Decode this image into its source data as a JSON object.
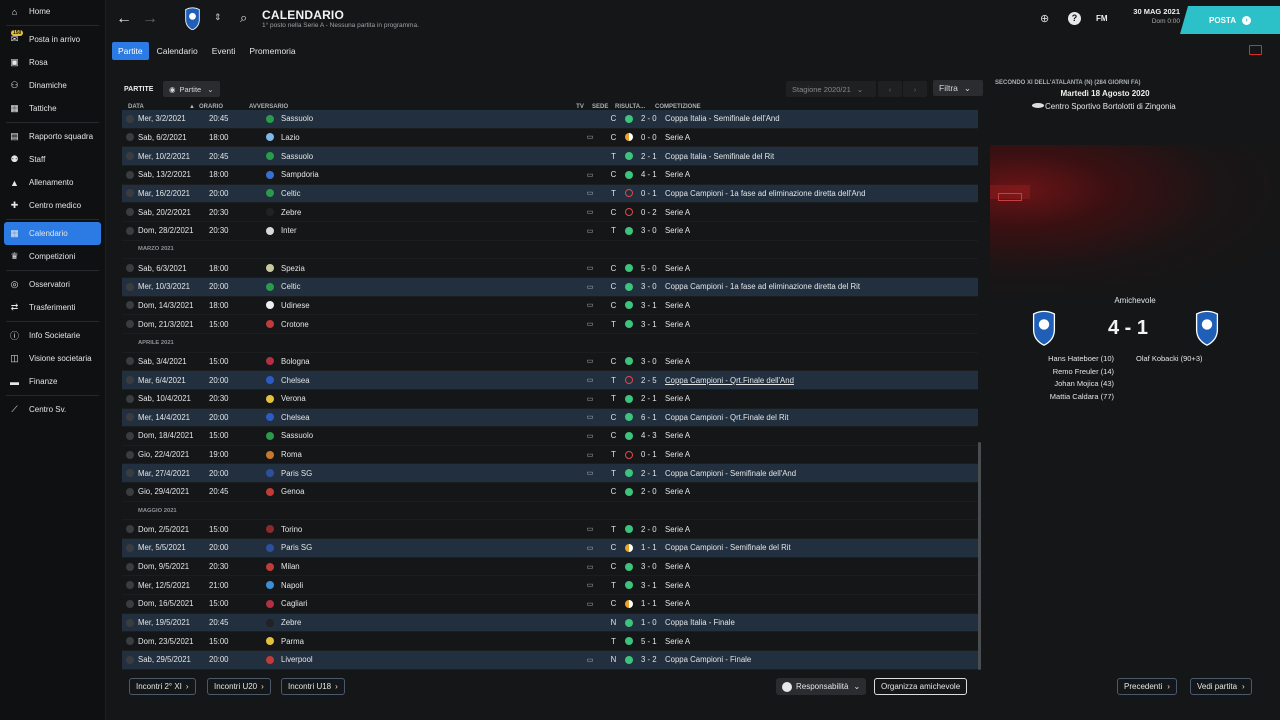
{
  "sidebar": {
    "items": [
      {
        "label": "Home",
        "icon": "home-icon",
        "glyph": "⌂"
      },
      {
        "label": "Posta in arrivo",
        "icon": "inbox-icon",
        "glyph": "✉",
        "badge": "150"
      },
      {
        "label": "Rosa",
        "icon": "shirt-icon",
        "glyph": "▣"
      },
      {
        "label": "Dinamiche",
        "icon": "dynamics-icon",
        "glyph": "⚇"
      },
      {
        "label": "Tattiche",
        "icon": "tactics-icon",
        "glyph": "▦"
      },
      {
        "label": "Rapporto squadra",
        "icon": "report-icon",
        "glyph": "▤"
      },
      {
        "label": "Staff",
        "icon": "staff-icon",
        "glyph": "⚉"
      },
      {
        "label": "Allenamento",
        "icon": "training-icon",
        "glyph": "▲"
      },
      {
        "label": "Centro medico",
        "icon": "medical-icon",
        "glyph": "✚"
      },
      {
        "label": "Calendario",
        "icon": "calendar-icon",
        "glyph": "▦",
        "active": true
      },
      {
        "label": "Competizioni",
        "icon": "trophy-icon",
        "glyph": "♛"
      },
      {
        "label": "Osservatori",
        "icon": "scout-icon",
        "glyph": "◎"
      },
      {
        "label": "Trasferimenti",
        "icon": "transfer-icon",
        "glyph": "⇄"
      },
      {
        "label": "Info Societarie",
        "icon": "info-icon",
        "glyph": "ⓘ"
      },
      {
        "label": "Visione societaria",
        "icon": "vision-icon",
        "glyph": "◫"
      },
      {
        "label": "Finanze",
        "icon": "finance-icon",
        "glyph": "▬"
      },
      {
        "label": "Centro Sv.",
        "icon": "dev-centre-icon",
        "glyph": "⟋"
      }
    ]
  },
  "header": {
    "title": "CALENDARIO",
    "subtitle": "1° posto nella Serie A - Nessuna partita in programma.",
    "fm_label": "FM",
    "date": "30 MAG 2021",
    "time": "Dom 0:00",
    "posta_label": "POSTA"
  },
  "tabs": [
    "Partite",
    "Calendario",
    "Eventi",
    "Promemoria"
  ],
  "controls": {
    "partite_label": "PARTITE",
    "view_dropdown": "Partite",
    "season_dropdown": "Stagione 2020/21",
    "filter_label": "Filtra"
  },
  "table": {
    "headers": {
      "date": "DATA",
      "time": "ORARIO",
      "opponent": "AVVERSARIO",
      "tv": "TV",
      "venue": "SEDE",
      "result": "RISULTA...",
      "competition": "COMPETIZIONE"
    },
    "rows": [
      {
        "date": "Mer, 3/2/2021",
        "time": "20:45",
        "opp": "Sassuolo",
        "crest": "#2a9a4b",
        "tv": false,
        "venue": "C",
        "res": "2 - 0",
        "dot": "win",
        "comp": "Coppa Italia - Semifinale dell'And",
        "alt": true
      },
      {
        "date": "Sab, 6/2/2021",
        "time": "18:00",
        "opp": "Lazio",
        "crest": "#7fb7e6",
        "tv": true,
        "venue": "C",
        "res": "0 - 0",
        "dot": "draw",
        "comp": "Serie A"
      },
      {
        "date": "Mer, 10/2/2021",
        "time": "20:45",
        "opp": "Sassuolo",
        "crest": "#2a9a4b",
        "tv": false,
        "venue": "T",
        "res": "2 - 1",
        "dot": "win",
        "comp": "Coppa Italia - Semifinale del Rit",
        "alt": true
      },
      {
        "date": "Sab, 13/2/2021",
        "time": "18:00",
        "opp": "Sampdoria",
        "crest": "#3a6fcf",
        "tv": true,
        "venue": "C",
        "res": "4 - 1",
        "dot": "win",
        "comp": "Serie A"
      },
      {
        "date": "Mar, 16/2/2021",
        "time": "20:00",
        "opp": "Celtic",
        "crest": "#2a9a4b",
        "tv": true,
        "venue": "T",
        "res": "0 - 1",
        "dot": "loss",
        "comp": "Coppa Campioni - 1a fase ad eliminazione diretta dell'And",
        "alt": true
      },
      {
        "date": "Sab, 20/2/2021",
        "time": "20:30",
        "opp": "Zebre",
        "crest": "#222",
        "tv": true,
        "venue": "C",
        "res": "0 - 2",
        "dot": "loss",
        "comp": "Serie A"
      },
      {
        "date": "Dom, 28/2/2021",
        "time": "20:30",
        "opp": "Inter",
        "crest": "#d8d8d8",
        "tv": true,
        "venue": "T",
        "res": "3 - 0",
        "dot": "win",
        "comp": "Serie A"
      },
      {
        "month": "MARZO 2021"
      },
      {
        "date": "Sab, 6/3/2021",
        "time": "18:00",
        "opp": "Spezia",
        "crest": "#c9c9a0",
        "tv": true,
        "venue": "C",
        "res": "5 - 0",
        "dot": "win",
        "comp": "Serie A"
      },
      {
        "date": "Mer, 10/3/2021",
        "time": "20:00",
        "opp": "Celtic",
        "crest": "#2a9a4b",
        "tv": true,
        "venue": "C",
        "res": "3 - 0",
        "dot": "win",
        "comp": "Coppa Campioni - 1a fase ad eliminazione diretta del Rit",
        "alt": true
      },
      {
        "date": "Dom, 14/3/2021",
        "time": "18:00",
        "opp": "Udinese",
        "crest": "#eeeeee",
        "tv": true,
        "venue": "C",
        "res": "3 - 1",
        "dot": "win",
        "comp": "Serie A"
      },
      {
        "date": "Dom, 21/3/2021",
        "time": "15:00",
        "opp": "Crotone",
        "crest": "#c23a3a",
        "tv": true,
        "venue": "T",
        "res": "3 - 1",
        "dot": "win",
        "comp": "Serie A"
      },
      {
        "month": "APRILE 2021"
      },
      {
        "date": "Sab, 3/4/2021",
        "time": "15:00",
        "opp": "Bologna",
        "crest": "#b23042",
        "tv": true,
        "venue": "C",
        "res": "3 - 0",
        "dot": "win",
        "comp": "Serie A"
      },
      {
        "date": "Mar, 6/4/2021",
        "time": "20:00",
        "opp": "Chelsea",
        "crest": "#2d5bc4",
        "tv": true,
        "venue": "T",
        "res": "2 - 5",
        "dot": "loss",
        "comp": "Coppa Campioni - Qrt.Finale dell'And",
        "alt": true,
        "ul": true
      },
      {
        "date": "Sab, 10/4/2021",
        "time": "20:30",
        "opp": "Verona",
        "crest": "#e3c23a",
        "tv": true,
        "venue": "T",
        "res": "2 - 1",
        "dot": "win",
        "comp": "Serie A"
      },
      {
        "date": "Mer, 14/4/2021",
        "time": "20:00",
        "opp": "Chelsea",
        "crest": "#2d5bc4",
        "tv": true,
        "venue": "C",
        "res": "6 - 1",
        "dot": "win",
        "comp": "Coppa Campioni - Qrt.Finale del Rit",
        "alt": true
      },
      {
        "date": "Dom, 18/4/2021",
        "time": "15:00",
        "opp": "Sassuolo",
        "crest": "#2a9a4b",
        "tv": true,
        "venue": "C",
        "res": "4 - 3",
        "dot": "win",
        "comp": "Serie A"
      },
      {
        "date": "Gio, 22/4/2021",
        "time": "19:00",
        "opp": "Roma",
        "crest": "#c8782a",
        "tv": true,
        "venue": "T",
        "res": "0 - 1",
        "dot": "loss",
        "comp": "Serie A"
      },
      {
        "date": "Mar, 27/4/2021",
        "time": "20:00",
        "opp": "Paris SG",
        "crest": "#2d4fa0",
        "tv": true,
        "venue": "T",
        "res": "2 - 1",
        "dot": "win",
        "comp": "Coppa Campioni - Semifinale dell'And",
        "alt": true
      },
      {
        "date": "Gio, 29/4/2021",
        "time": "20:45",
        "opp": "Genoa",
        "crest": "#c23a3a",
        "tv": false,
        "venue": "C",
        "res": "2 - 0",
        "dot": "win",
        "comp": "Serie A"
      },
      {
        "month": "MAGGIO 2021"
      },
      {
        "date": "Dom, 2/5/2021",
        "time": "15:00",
        "opp": "Torino",
        "crest": "#8a2a2a",
        "tv": true,
        "venue": "T",
        "res": "2 - 0",
        "dot": "win",
        "comp": "Serie A"
      },
      {
        "date": "Mer, 5/5/2021",
        "time": "20:00",
        "opp": "Paris SG",
        "crest": "#2d4fa0",
        "tv": true,
        "venue": "C",
        "res": "1 - 1",
        "dot": "draw",
        "comp": "Coppa Campioni - Semifinale del Rit",
        "alt": true
      },
      {
        "date": "Dom, 9/5/2021",
        "time": "20:30",
        "opp": "Milan",
        "crest": "#c23a3a",
        "tv": true,
        "venue": "C",
        "res": "3 - 0",
        "dot": "win",
        "comp": "Serie A"
      },
      {
        "date": "Mer, 12/5/2021",
        "time": "21:00",
        "opp": "Napoli",
        "crest": "#3a8fd6",
        "tv": true,
        "venue": "T",
        "res": "3 - 1",
        "dot": "win",
        "comp": "Serie A"
      },
      {
        "date": "Dom, 16/5/2021",
        "time": "15:00",
        "opp": "Cagliari",
        "crest": "#b23042",
        "tv": true,
        "venue": "C",
        "res": "1 - 1",
        "dot": "draw",
        "comp": "Serie A"
      },
      {
        "date": "Mer, 19/5/2021",
        "time": "20:45",
        "opp": "Zebre",
        "crest": "#222",
        "tv": false,
        "venue": "N",
        "res": "1 - 0",
        "dot": "win",
        "comp": "Coppa Italia - Finale",
        "alt": true
      },
      {
        "date": "Dom, 23/5/2021",
        "time": "15:00",
        "opp": "Parma",
        "crest": "#e3c23a",
        "tv": false,
        "venue": "T",
        "res": "5 - 1",
        "dot": "win",
        "comp": "Serie A"
      },
      {
        "date": "Sab, 29/5/2021",
        "time": "20:00",
        "opp": "Liverpool",
        "crest": "#c23a3a",
        "tv": true,
        "venue": "N",
        "res": "3 - 2",
        "dot": "win",
        "comp": "Coppa Campioni - Finale",
        "alt": true
      }
    ]
  },
  "bottom": {
    "btn1": "Incontri 2° XI",
    "btn2": "Incontri U20",
    "btn3": "Incontri U18",
    "resp": "Responsabilità",
    "friendly": "Organizza amichevole",
    "prev": "Precedenti",
    "view": "Vedi partita"
  },
  "right": {
    "section": "SECONDO XI DELL'ATALANTA (N) (284 GIORNI FA)",
    "date": "Martedì 18 Agosto 2020",
    "venue": "Centro Sportivo Bortolotti di Zingonia",
    "type": "Amichevole",
    "score": "4 - 1",
    "home_scorers": [
      "Hans Hateboer (10)",
      "Remo Freuler (14)",
      "Johan Mojica (43)",
      "Mattia Caldara (77)"
    ],
    "away_scorers": [
      "Olaf Kobacki (90+3)"
    ]
  },
  "colors": {
    "accent": "#2c7be5",
    "win": "#3cc47c",
    "draw": "#e8a12a",
    "loss": "#e24848",
    "alt_row": "#212f3e",
    "posta": "#2cc0c8"
  }
}
